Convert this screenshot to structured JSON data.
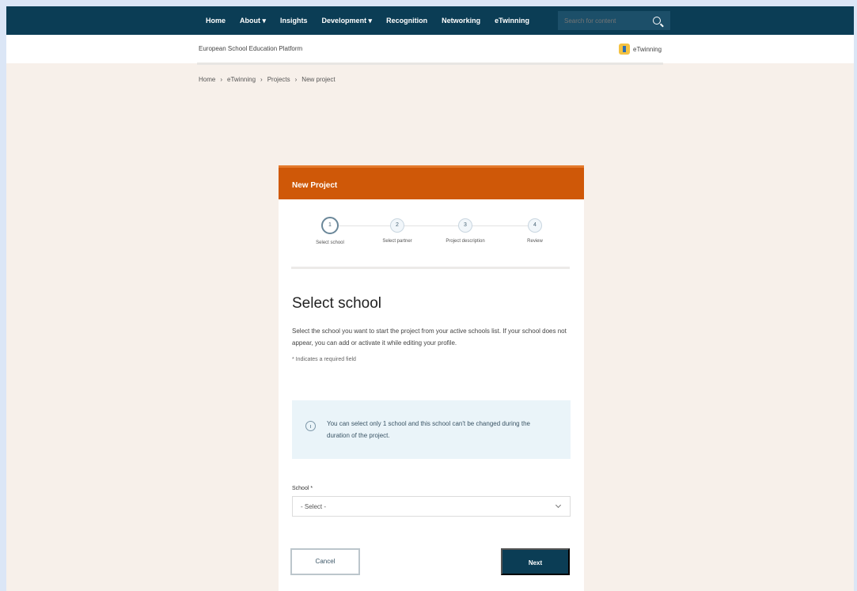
{
  "nav": {
    "items": [
      "Home",
      "About ▾",
      "Insights",
      "Development ▾",
      "Recognition",
      "Networking",
      "eTwinning"
    ],
    "search_placeholder": "Search for content"
  },
  "subheader": {
    "platform": "European School Education Platform",
    "etwinning": "eTwinning"
  },
  "breadcrumb": [
    "Home",
    "›",
    "eTwinning",
    "›",
    "Projects",
    "›",
    "New project"
  ],
  "card": {
    "title": "New Project",
    "steps": [
      {
        "number": "1",
        "label": "Select school"
      },
      {
        "number": "2",
        "label": "Select partner"
      },
      {
        "number": "3",
        "label": "Project description"
      },
      {
        "number": "4",
        "label": "Review"
      }
    ],
    "heading": "Select school",
    "description": "Select the school you want to start the project from your active schools list. If your school does not appear, you can add or activate it while editing your profile.",
    "required_note": "* Indicates a required field",
    "info": "You can select only 1 school and this school can't be changed during the duration of the project.",
    "field_label": "School *",
    "select_value": "- Select -",
    "cancel": "Cancel",
    "next": "Next"
  }
}
